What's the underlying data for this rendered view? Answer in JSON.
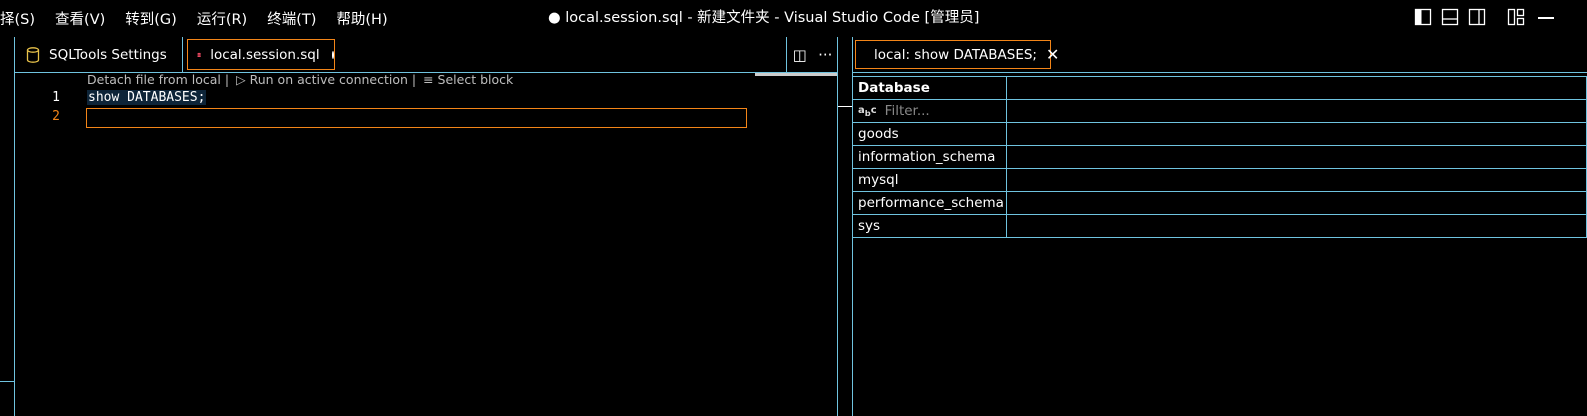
{
  "menu": [
    "择(S)",
    "查看(V)",
    "转到(G)",
    "运行(R)",
    "终端(T)",
    "帮助(H)"
  ],
  "window_title": "● local.session.sql - 新建文件夹 - Visual Studio Code [管理员]",
  "editor_tabs": [
    {
      "label": "SQLTools Settings",
      "icon": "database-icon"
    },
    {
      "label": "local.session.sql",
      "icon": "database-stack-icon",
      "dirty": true
    }
  ],
  "tab_actions": {
    "split": "◫",
    "more": "···"
  },
  "codelens": {
    "detach": "Detach file from local |",
    "run": "▷ Run on active connection |",
    "select": "≡ Select block"
  },
  "code": {
    "lines": [
      "show DATABASES;",
      ""
    ],
    "line_numbers": [
      "1",
      "2"
    ]
  },
  "results_tab": {
    "label": "local: show DATABASES;",
    "close": "✕"
  },
  "results": {
    "column": "Database",
    "filter_placeholder": "Filter...",
    "rows": [
      "goods",
      "information_schema",
      "mysql",
      "performance_schema",
      "sys"
    ]
  },
  "colors": {
    "accent_border": "#6fc3df",
    "active_border": "#f38518"
  }
}
